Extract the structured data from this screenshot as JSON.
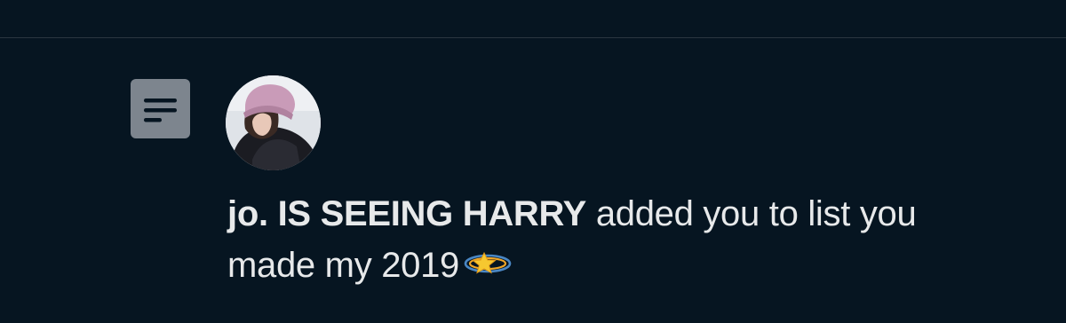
{
  "notification": {
    "type": "list-added",
    "display_name": "jo. IS SEEING HARRY",
    "action_text": " added you to list ",
    "list_name": "you made my 2019",
    "list_icon": "list-icon",
    "avatar_icon": "profile-avatar",
    "emoji_icon": "dizzy-star-emoji"
  },
  "colors": {
    "background": "#061521",
    "text": "#e7e9ea",
    "badge": "#7d858e",
    "divider": "#2a3540"
  }
}
